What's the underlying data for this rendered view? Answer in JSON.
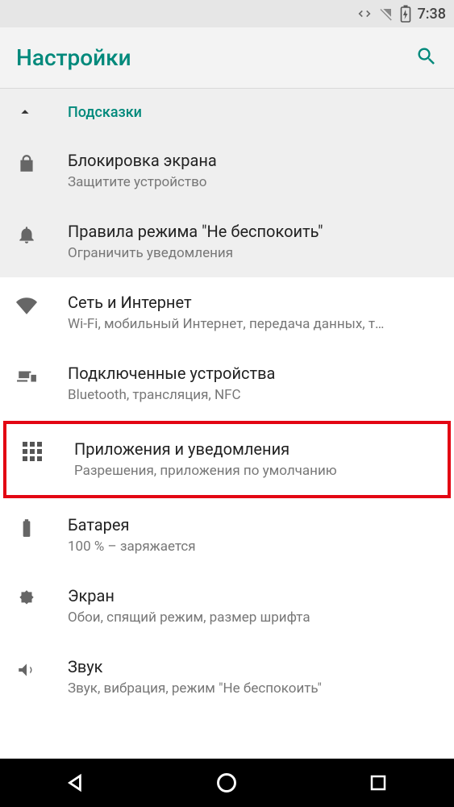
{
  "status_bar": {
    "time": "7:38"
  },
  "app_bar": {
    "title": "Настройки"
  },
  "hints": {
    "header": "Подсказки",
    "items": [
      {
        "title": "Блокировка экрана",
        "sub": "Защитите устройство"
      },
      {
        "title": "Правила режима \"Не беспокоить\"",
        "sub": "Ограничить уведомления"
      }
    ]
  },
  "settings": [
    {
      "title": "Сеть и Интернет",
      "sub": "Wi-Fi, мобильный Интернет, передача данных, т…"
    },
    {
      "title": "Подключенные устройства",
      "sub": "Bluetooth, трансляция, NFC"
    },
    {
      "title": "Приложения и уведомления",
      "sub": "Разрешения, приложения по умолчанию"
    },
    {
      "title": "Батарея",
      "sub": "100 % – заряжается"
    },
    {
      "title": "Экран",
      "sub": "Обои, спящий режим, размер шрифта"
    },
    {
      "title": "Звук",
      "sub": "Звук, вибрация, режим \"Не беспокоить\""
    }
  ],
  "highlighted_index": 2
}
